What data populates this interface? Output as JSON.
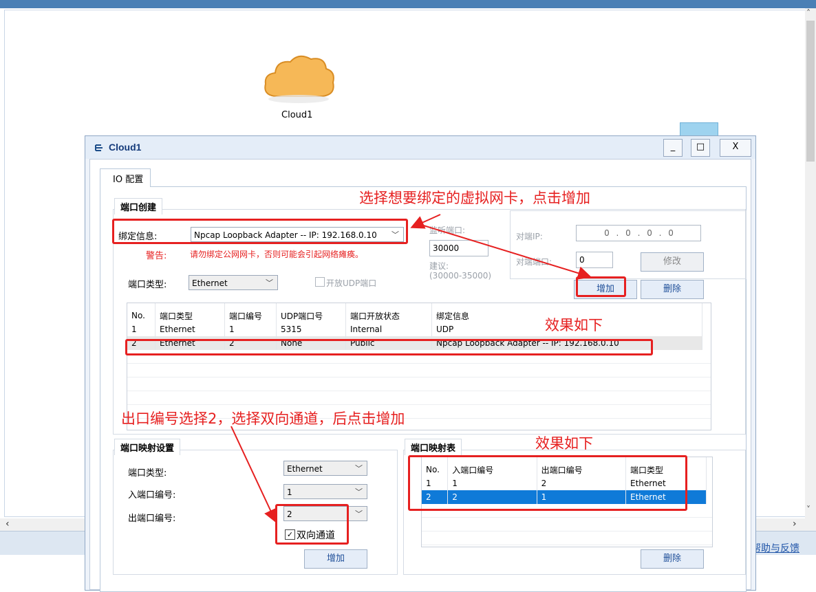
{
  "workspace": {
    "cloud_label": "Cloud1",
    "help_link": "帮助与反馈"
  },
  "dialog": {
    "title": "Cloud1",
    "min_btn": "_",
    "max_btn": "□",
    "close_btn": "X",
    "tab_label": "IO 配置"
  },
  "port_create": {
    "group_title": "端口创建",
    "bind_label": "绑定信息:",
    "bind_value": "Npcap Loopback Adapter -- IP: 192.168.0.10",
    "warning_label": "警告:",
    "warning_text": "请勿绑定公网网卡，否则可能会引起网络瘫痪。",
    "port_type_label": "端口类型:",
    "port_type_value": "Ethernet",
    "open_udp_label": "开放UDP端口",
    "listen_port_label": "监听端口:",
    "listen_port_value": "30000",
    "suggest_label": "建议:",
    "suggest_range": "(30000-35000)",
    "peer_ip_label": "对端IP:",
    "peer_ip_value": "0 . 0 . 0 . 0",
    "peer_port_label": "对端端口:",
    "peer_port_value": "0",
    "modify_btn": "修改",
    "add_btn": "增加",
    "delete_btn": "删除"
  },
  "port_table": {
    "headers": [
      "No.",
      "端口类型",
      "端口编号",
      "UDP端口号",
      "端口开放状态",
      "绑定信息"
    ],
    "rows": [
      [
        "1",
        "Ethernet",
        "1",
        "5315",
        "Internal",
        "UDP"
      ],
      [
        "2",
        "Ethernet",
        "2",
        "None",
        "Public",
        "Npcap Loopback Adapter -- IP: 192.168.0.10"
      ]
    ]
  },
  "mapping_settings": {
    "group_title": "端口映射设置",
    "port_type_label": "端口类型:",
    "port_type_value": "Ethernet",
    "in_port_label": "入端口编号:",
    "in_port_value": "1",
    "out_port_label": "出端口编号:",
    "out_port_value": "2",
    "bidirectional_label": "双向通道",
    "bidirectional_checked": true,
    "add_btn": "增加"
  },
  "mapping_table": {
    "group_title": "端口映射表",
    "headers": [
      "No.",
      "入端口编号",
      "出端口编号",
      "端口类型"
    ],
    "rows": [
      [
        "1",
        "1",
        "2",
        "Ethernet"
      ],
      [
        "2",
        "2",
        "1",
        "Ethernet"
      ]
    ],
    "delete_btn": "删除"
  },
  "annotations": {
    "select_adapter": "选择想要绑定的虚拟网卡，点击增加",
    "effect_1": "效果如下",
    "out_port_tip": "出口编号选择2，选择双向通道，后点击增加",
    "effect_2": "效果如下"
  },
  "colors": {
    "annotation_red": "#e62020",
    "selection_blue": "#0f7ad8"
  }
}
